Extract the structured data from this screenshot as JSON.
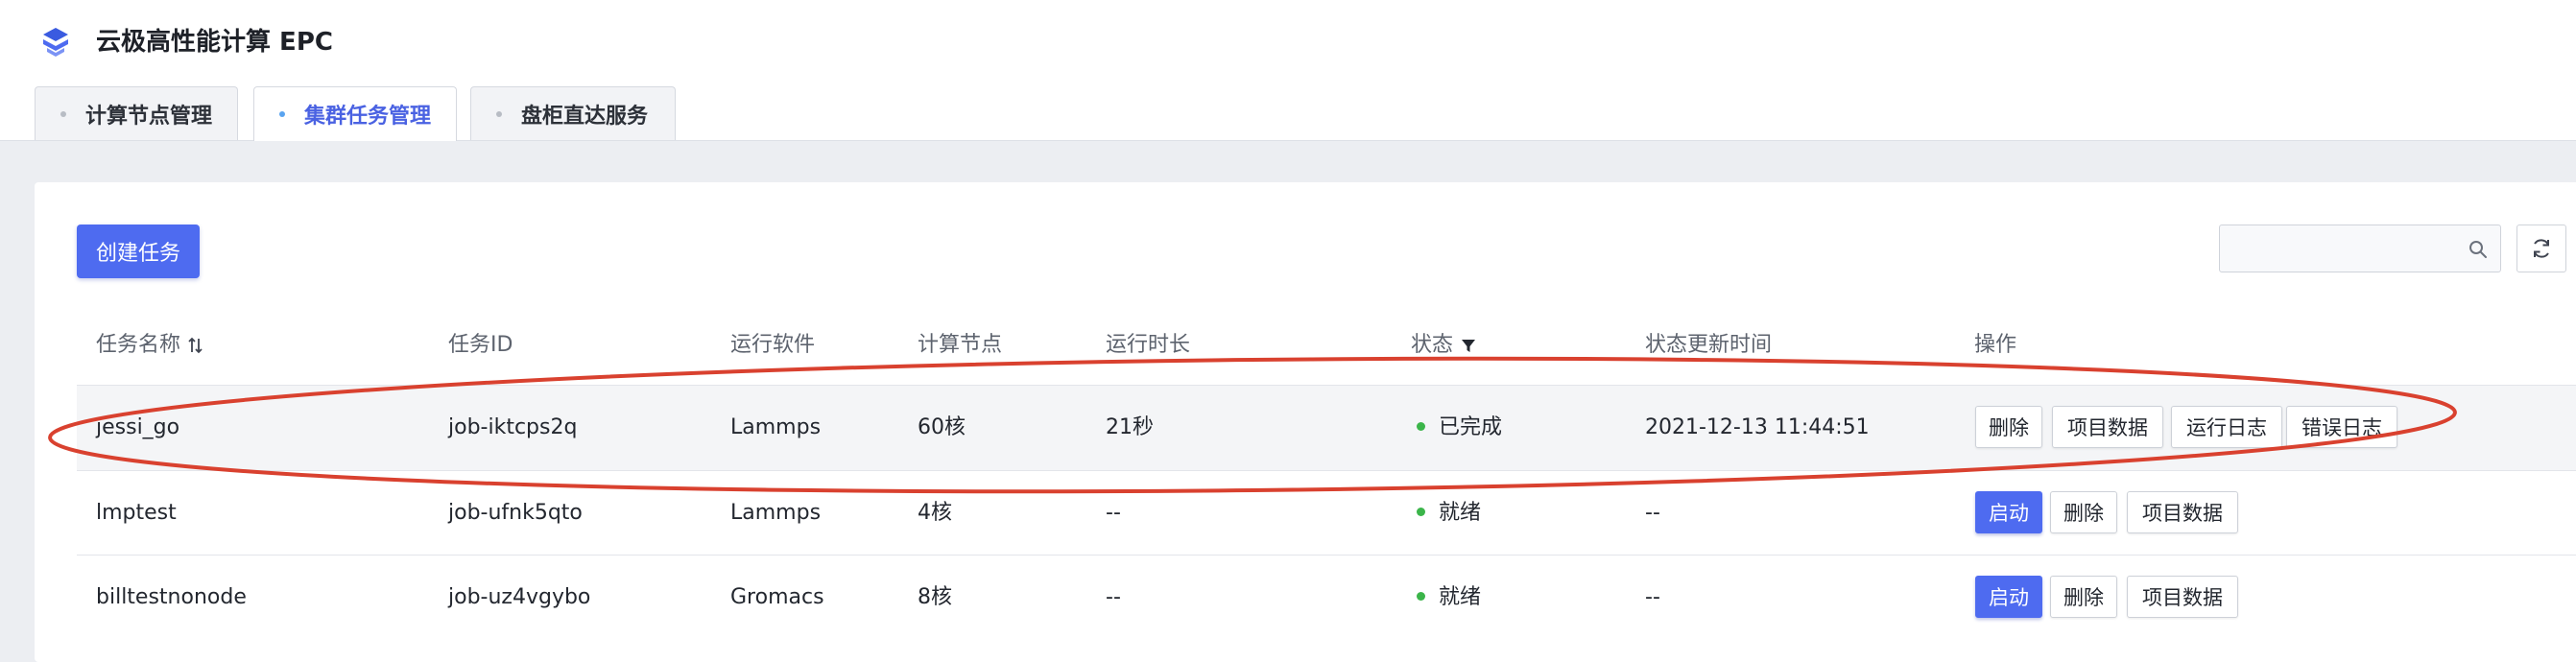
{
  "app": {
    "title": "云极高性能计算 EPC"
  },
  "tabs": [
    {
      "label": "计算节点管理"
    },
    {
      "label": "集群任务管理"
    },
    {
      "label": "盘柜直达服务"
    }
  ],
  "toolbar": {
    "create_label": "创建任务",
    "search_value": "",
    "search_placeholder": ""
  },
  "table": {
    "headers": {
      "name": "任务名称",
      "id": "任务ID",
      "software": "运行软件",
      "nodes": "计算节点",
      "duration": "运行时长",
      "status": "状态",
      "updated": "状态更新时间",
      "actions": "操作"
    },
    "rows": [
      {
        "name": "jessi_go",
        "id": "job-iktcps2q",
        "software": "Lammps",
        "nodes": "60核",
        "duration": "21秒",
        "status": "已完成",
        "updated": "2021-12-13 11:44:51",
        "actions": [
          "删除",
          "项目数据",
          "运行日志",
          "错误日志"
        ]
      },
      {
        "name": "lmptest",
        "id": "job-ufnk5qto",
        "software": "Lammps",
        "nodes": "4核",
        "duration": "--",
        "status": "就绪",
        "updated": "--",
        "actions": [
          "启动",
          "删除",
          "项目数据"
        ]
      },
      {
        "name": "billtestnonode",
        "id": "job-uz4vgybo",
        "software": "Gromacs",
        "nodes": "8核",
        "duration": "--",
        "status": "就绪",
        "updated": "--",
        "actions": [
          "启动",
          "删除",
          "项目数据"
        ]
      }
    ]
  },
  "colors": {
    "accent": "#4e6bf0",
    "status_ok": "#3bb54a",
    "annotation": "#d9412f"
  }
}
